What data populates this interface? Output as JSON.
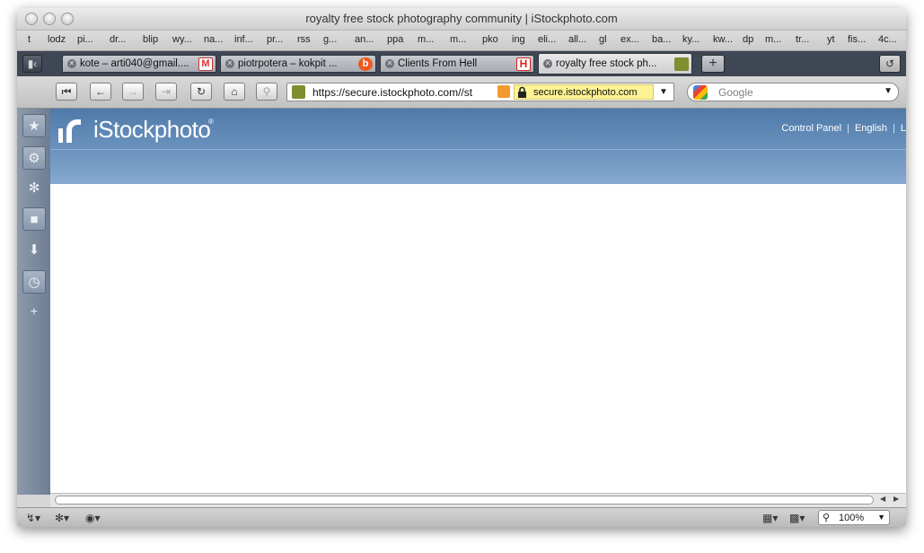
{
  "window": {
    "title": "royalty free stock photography community | iStockphoto.com"
  },
  "bookmarks": [
    "t",
    "lodz",
    "pi...",
    "dr...",
    "blip",
    "wy...",
    "na...",
    "inf...",
    "pr...",
    "rss",
    "g...",
    "an...",
    "ppa",
    "m...",
    "m...",
    "pko",
    "ing",
    "eli...",
    "all...",
    "gl",
    "ex...",
    "ba...",
    "ky...",
    "kw...",
    "dp",
    "m...",
    "tr...",
    "yt",
    "fis...",
    "4c..."
  ],
  "tabs": [
    {
      "label": "kote – arti040@gmail....",
      "favicon": "gmail-icon"
    },
    {
      "label": "piotrpotera – kokpit ...",
      "favicon": "blip-icon"
    },
    {
      "label": "Clients From Hell",
      "favicon": "h-icon"
    },
    {
      "label": "royalty free stock ph...",
      "favicon": "istock-icon",
      "active": true
    }
  ],
  "toolbar": {
    "url": "https://secure.istockphoto.com//st",
    "secure_domain": "secure.istockphoto.com",
    "search_placeholder": "Google"
  },
  "page": {
    "logo_text": "iStockphoto",
    "logo_reg": "®",
    "nav": [
      "Control Panel",
      "English",
      "L"
    ]
  },
  "statusbar": {
    "zoom": "100%"
  },
  "colors": {
    "hero_top": "#4f79a8",
    "hero_bottom": "#86a9cf",
    "tabbar": "#3f4654",
    "sidebar": "#7a889d"
  }
}
